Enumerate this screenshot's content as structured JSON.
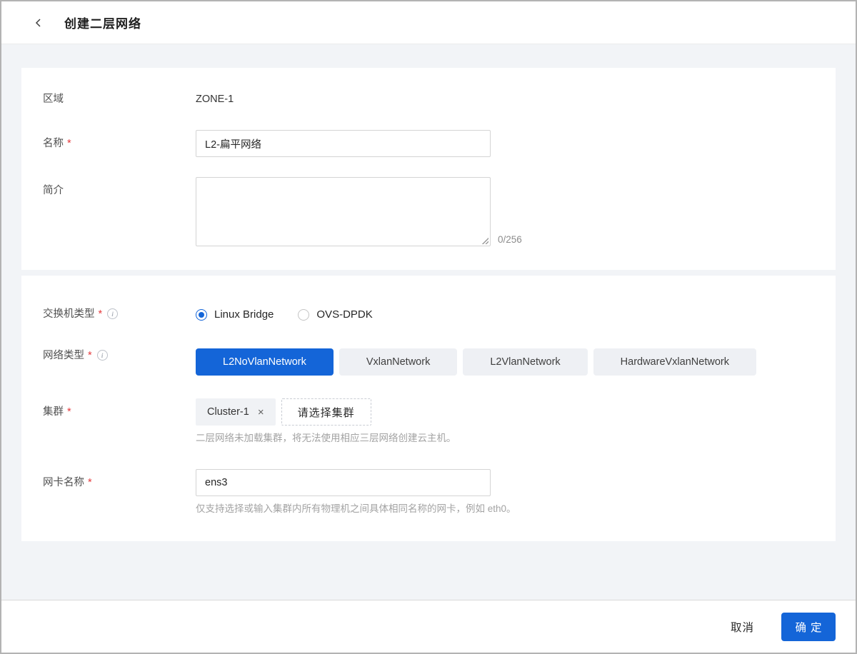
{
  "icons": {
    "info": "i",
    "close": "×"
  },
  "marks": {
    "required": "*"
  },
  "colors": {
    "primary_blue": "#1465d8",
    "page_bg": "#f2f4f7",
    "required_red": "#e5393c"
  },
  "header": {
    "title": "创建二层网络"
  },
  "basic": {
    "zone": {
      "label": "区域",
      "value": "ZONE-1"
    },
    "name": {
      "label": "名称",
      "value": "L2-扁平网络"
    },
    "description": {
      "label": "简介",
      "value": "",
      "counter": "0/256"
    }
  },
  "network": {
    "switch_type": {
      "label": "交换机类型",
      "options": [
        {
          "label": "Linux Bridge",
          "selected": true
        },
        {
          "label": "OVS-DPDK",
          "selected": false
        }
      ]
    },
    "network_type": {
      "label": "网络类型",
      "selected": "L2NoVlanNetwork",
      "options": [
        "L2NoVlanNetwork",
        "VxlanNetwork",
        "L2VlanNetwork",
        "HardwareVxlanNetwork"
      ]
    },
    "cluster": {
      "label": "集群",
      "selected_tag": "Cluster-1",
      "select_button": "请选择集群",
      "helper": "二层网络未加载集群，将无法使用相应三层网络创建云主机。"
    },
    "nic_name": {
      "label": "网卡名称",
      "value": "ens3",
      "helper": "仅支持选择或输入集群内所有物理机之间具体相同名称的网卡，例如 eth0。"
    }
  },
  "footer": {
    "cancel": "取消",
    "confirm": "确定"
  }
}
